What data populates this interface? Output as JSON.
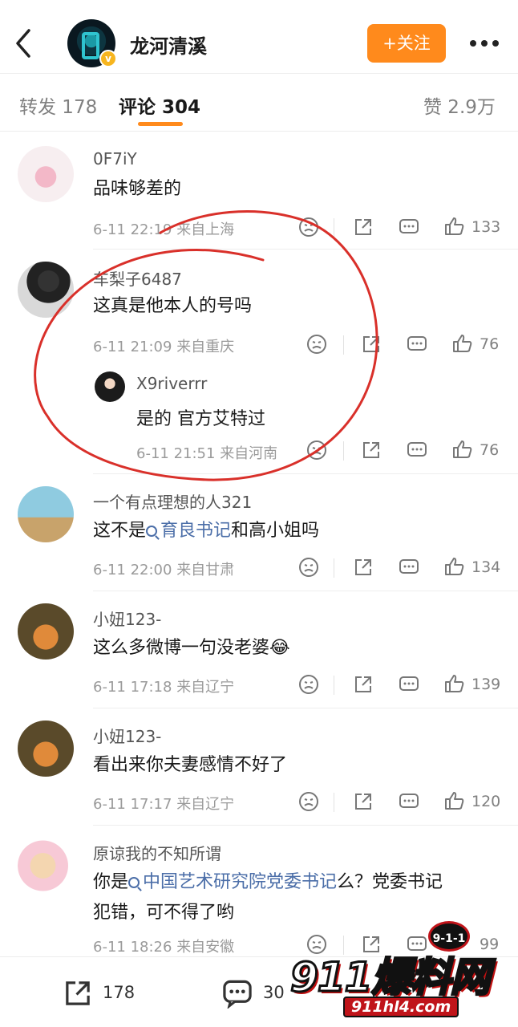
{
  "header": {
    "account_name": "龙河清溪",
    "follow_label": "+关注"
  },
  "tabs": {
    "repost": "转发 178",
    "comments": "评论 304",
    "likes": "赞 2.9万"
  },
  "comments": [
    {
      "user": "0F7iY",
      "text": "品味够差的",
      "time": "6-11 22:19",
      "location": "来自上海",
      "likes": "133"
    },
    {
      "user": "车梨子6487",
      "text": "这真是他本人的号吗",
      "time": "6-11 21:09",
      "location": "来自重庆",
      "likes": "76",
      "reply": {
        "user": "X9riverrr",
        "text": "是的  官方艾特过",
        "time": "6-11 21:51",
        "location": "来自河南",
        "likes": "76"
      }
    },
    {
      "user": "一个有点理想的人321",
      "text_before": "这不是",
      "link": "育良书记",
      "text_after": "和高小姐吗",
      "time": "6-11 22:00",
      "location": "来自甘肃",
      "likes": "134"
    },
    {
      "user": "小妞123-",
      "text": "这么多微博一句没老婆😂",
      "time": "6-11 17:18",
      "location": "来自辽宁",
      "likes": "139"
    },
    {
      "user": "小妞123-",
      "text": "看出来你夫妻感情不好了",
      "time": "6-11 17:17",
      "location": "来自辽宁",
      "likes": "120"
    },
    {
      "user": "原谅我的不知所谓",
      "text_before": "你是",
      "link": "中国艺术研究院党委书记",
      "text_after": "么？党委书记",
      "text_line2": "犯错，可不得了哟",
      "time": "6-11 18:26",
      "location": "来自安徽",
      "likes": "99"
    }
  ],
  "bottom_bar": {
    "repost_count": "178",
    "comment_count": "30"
  },
  "watermark": {
    "badge": "9-1-1",
    "main": "911爆料网",
    "sub": "911hl4.com"
  },
  "colors": {
    "accent": "#ff8a1c",
    "link": "#4b6ea8",
    "annotation": "#d9302a"
  }
}
